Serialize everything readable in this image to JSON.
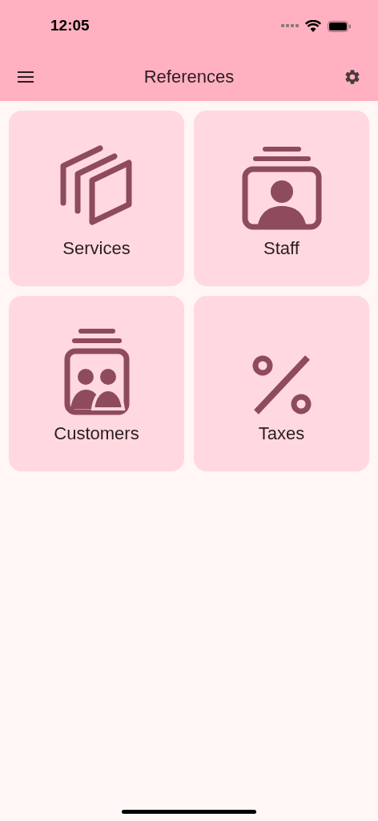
{
  "status_bar": {
    "time": "12:05"
  },
  "app_bar": {
    "title": "References"
  },
  "tiles": [
    {
      "kind": "services",
      "label": "Services"
    },
    {
      "kind": "staff",
      "label": "Staff"
    },
    {
      "kind": "customers",
      "label": "Customers"
    },
    {
      "kind": "taxes",
      "label": "Taxes"
    }
  ]
}
